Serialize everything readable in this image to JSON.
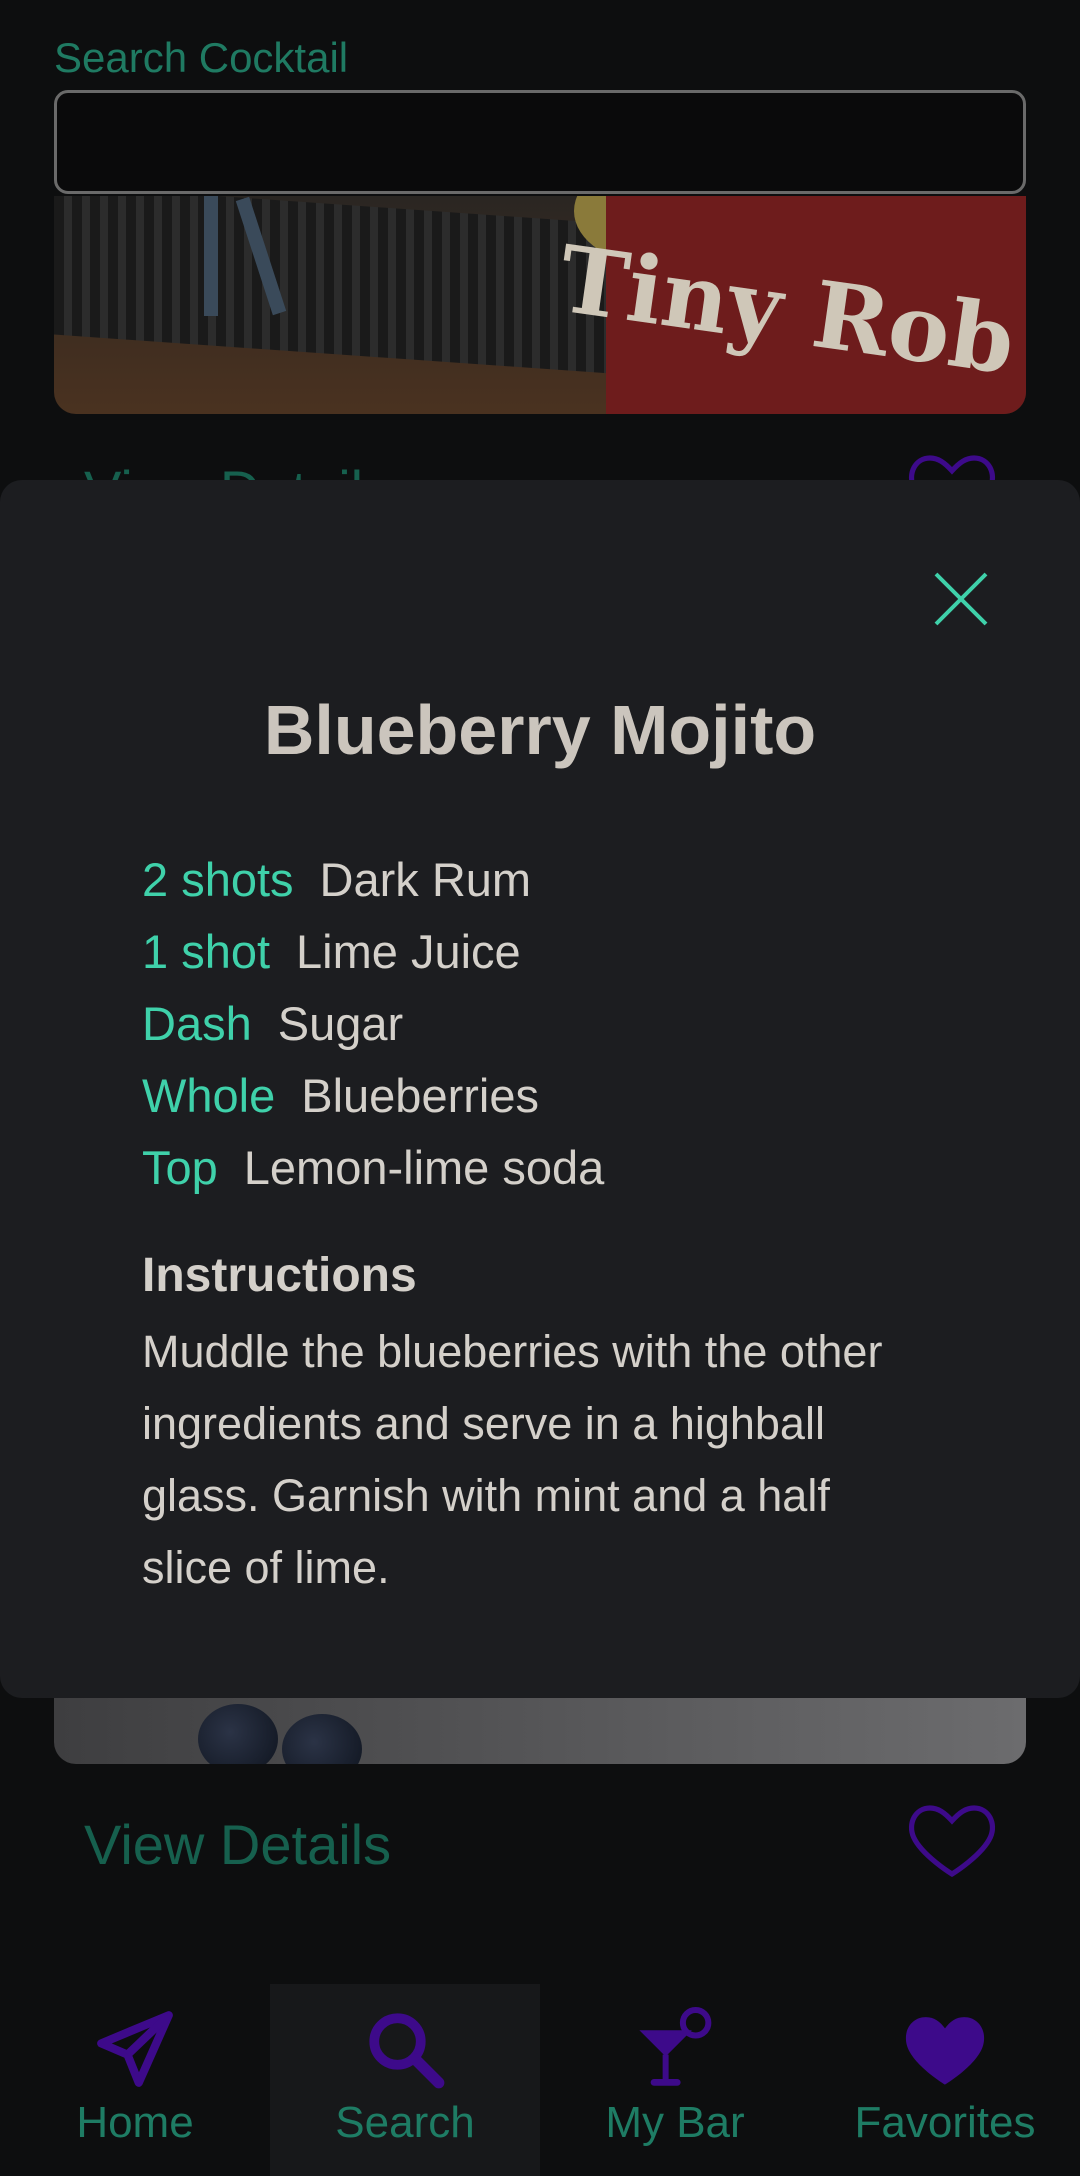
{
  "search": {
    "label": "Search Cocktail",
    "value": ""
  },
  "cards": [
    {
      "view_details_label": "View Details",
      "image_alt": "Tiny Rob"
    },
    {
      "view_details_label": "View Details"
    }
  ],
  "modal": {
    "title": "Blueberry Mojito",
    "ingredients": [
      {
        "amount": "2 shots",
        "name": "Dark Rum"
      },
      {
        "amount": "1 shot",
        "name": "Lime Juice"
      },
      {
        "amount": "Dash",
        "name": "Sugar"
      },
      {
        "amount": "Whole",
        "name": "Blueberries"
      },
      {
        "amount": "Top",
        "name": "Lemon-lime soda"
      }
    ],
    "instructions_heading": "Instructions",
    "instructions": "Muddle the blueberries with the other ingredients and serve in a highball glass. Garnish with mint and a half slice of lime."
  },
  "nav": {
    "items": [
      {
        "label": "Home",
        "icon": "paper-plane-icon"
      },
      {
        "label": "Search",
        "icon": "search-icon",
        "active": true
      },
      {
        "label": "My Bar",
        "icon": "cocktail-glass-icon"
      },
      {
        "label": "Favorites",
        "icon": "heart-icon"
      }
    ]
  },
  "colors": {
    "accent": "#3fd1aa",
    "icon_purple": "#3d0a8a",
    "background": "#0d0e0f",
    "modal_bg": "#1c1d20"
  }
}
